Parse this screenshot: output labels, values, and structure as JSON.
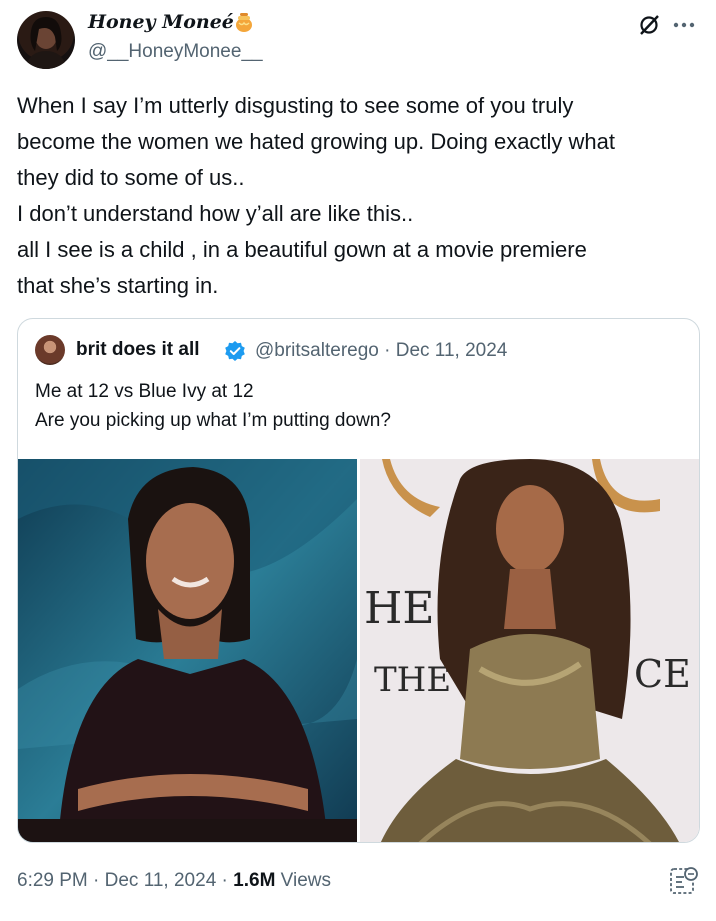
{
  "author": {
    "name": "Honey Moneé",
    "handle": "@__HoneyMonee__"
  },
  "icons": {
    "avatar": "profile-photo",
    "honey": "honey-pot-icon",
    "grok": "grok-icon",
    "more": "more-dots-icon",
    "verified": "verified-badge-icon",
    "analytics": "analytics-icon"
  },
  "tweet": {
    "lines": [
      "When I say I’m utterly disgusting to see some of you truly",
      "become the women we hated growing up. Doing exactly what",
      "they did to some of us..",
      "I don’t understand how y’all are like this..",
      "all I see is a child , in a beautiful gown at a movie premiere",
      "that she’s starting in."
    ]
  },
  "quote": {
    "name": "brit does it all",
    "meta": "@britsalterego · Dec 11, 2024",
    "lines": [
      "Me at 12 vs Blue Ivy at 12",
      "Are you picking up what I’m putting down?"
    ],
    "images": [
      "photo-school-portrait",
      "photo-premiere-gown"
    ],
    "backdrop_text": [
      "HE",
      "THE",
      "CE"
    ]
  },
  "footer": {
    "time": "6:29 PM · Dec 11, 2024 · ",
    "views_count": "1.6M",
    "views_label": " Views"
  },
  "colors": {
    "text": "#0f1419",
    "secondary": "#536471",
    "border": "#cfd9de",
    "verified": "#1d9bf0"
  }
}
